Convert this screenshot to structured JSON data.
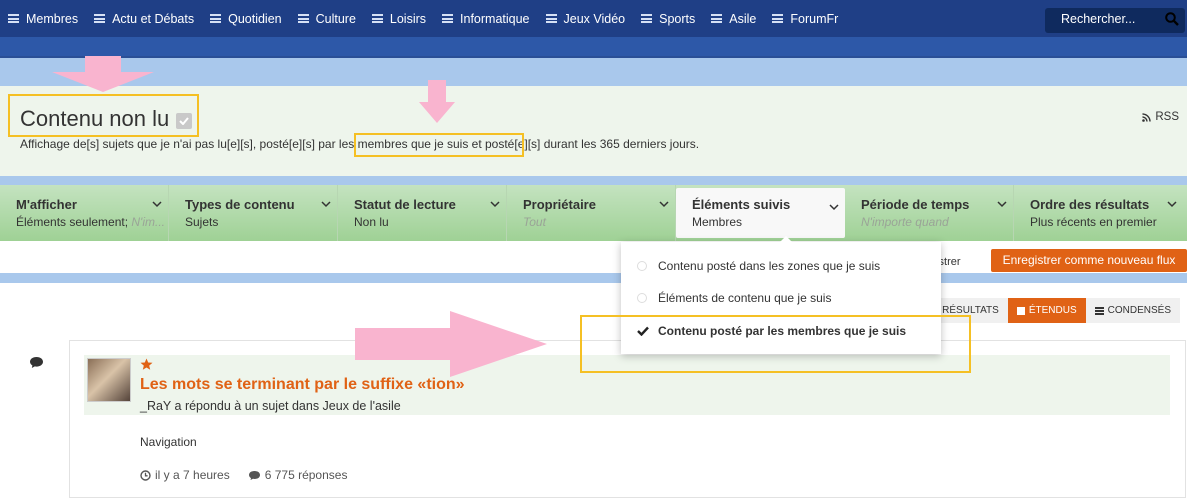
{
  "nav": {
    "items": [
      "Membres",
      "Actu et Débats",
      "Quotidien",
      "Culture",
      "Loisirs",
      "Informatique",
      "Jeux Vidéo",
      "Sports",
      "Asile",
      "ForumFr"
    ],
    "search_placeholder": "Rechercher..."
  },
  "header": {
    "title": "Contenu non lu",
    "rss": "RSS",
    "desc_before": "Affichage de[s] sujets que je n'ai pas lu[e][s], posté[e][s] ",
    "desc_highlight": "par les membres que je suis",
    "desc_after": " et posté[e][s] durant les 365 derniers jours."
  },
  "filters": [
    {
      "title": "M'afficher",
      "value": "Éléments seulement; ",
      "muted": "N'im..."
    },
    {
      "title": "Types de contenu",
      "value": "Sujets",
      "muted": ""
    },
    {
      "title": "Statut de lecture",
      "value": "Non lu",
      "muted": ""
    },
    {
      "title": "Propriétaire",
      "value": "",
      "muted": "Tout"
    },
    {
      "title": "Éléments suivis",
      "value": "Membres",
      "muted": ""
    },
    {
      "title": "Période de temps",
      "value": "",
      "muted": "N'importe quand"
    },
    {
      "title": "Ordre des résultats",
      "value": "Plus récents en premier",
      "muted": ""
    }
  ],
  "actions": {
    "registrer_partial": "gistrer",
    "save_label": "Enregistrer comme nouveau flux"
  },
  "view": {
    "results_partial": "RÉSULTATS",
    "expanded": "ÉTENDUS",
    "condensed": "CONDENSÉS"
  },
  "dropdown": {
    "items": [
      {
        "label": "Contenu posté dans les zones que je suis",
        "selected": false
      },
      {
        "label": "Éléments de contenu que je suis",
        "selected": false
      },
      {
        "label": "Contenu posté par les membres que je suis",
        "selected": true
      }
    ]
  },
  "topic": {
    "title": "Les mots se terminant par le suffixe «tion»",
    "meta": "_RaY a répondu à un sujet dans Jeux de l'asile",
    "nav": "Navigation",
    "time": "il y a 7 heures",
    "replies": "6 775 réponses"
  },
  "colors": {
    "nav_bg": "#1f3f86",
    "accent": "#e06215",
    "filter_green": "#a8d59f",
    "highlight_box": "#f5c024",
    "arrow_pink": "#f9b4cf"
  }
}
